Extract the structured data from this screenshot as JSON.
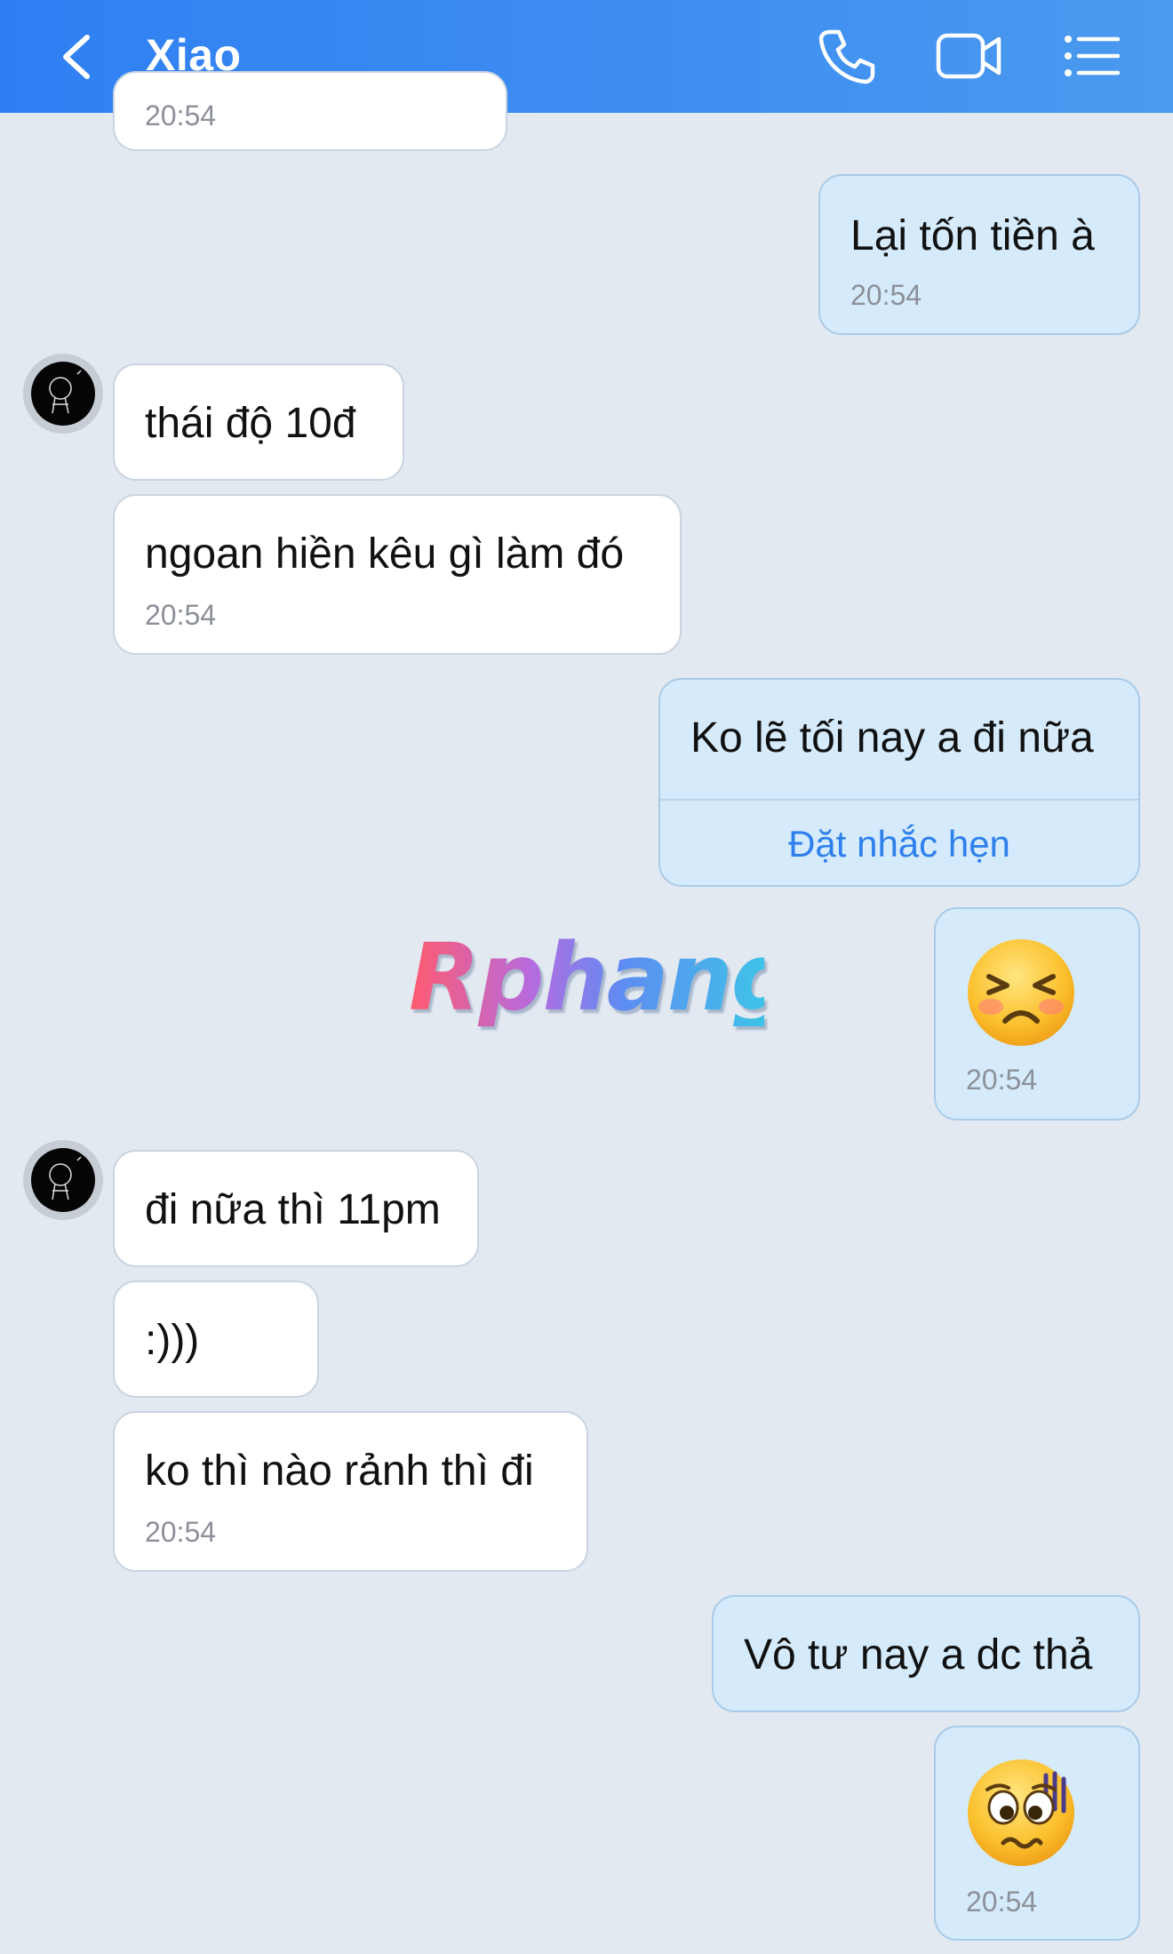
{
  "header": {
    "title": "Xiao",
    "back_icon": "chevron-left-icon",
    "call_icon": "phone-icon",
    "video_icon": "video-camera-icon",
    "menu_icon": "list-menu-icon"
  },
  "colors": {
    "header_start": "#2f7ff3",
    "header_end": "#4a9af0",
    "background": "#e2e9f1",
    "incoming_bubble": "#ffffff",
    "outgoing_bubble": "#d5ebfb",
    "link": "#2f80ed"
  },
  "messages": [
    {
      "dir": "in",
      "time": "20:54"
    },
    {
      "dir": "out",
      "text": "Lại tốn tiền à",
      "time": "20:54"
    },
    {
      "dir": "in",
      "text": "thái độ 10đ"
    },
    {
      "dir": "in",
      "text": "ngoan hiền kêu gì làm đó",
      "time": "20:54"
    },
    {
      "dir": "out",
      "text": "Ko lẽ tối nay a đi nữa",
      "action": "Đặt nhắc hẹn"
    },
    {
      "dir": "out",
      "emoji": "squinting-frown-emoji",
      "time": "20:54"
    },
    {
      "dir": "in",
      "text": "đi nữa thì 11pm"
    },
    {
      "dir": "in",
      "text": ":)))"
    },
    {
      "dir": "in",
      "text": "ko thì nào rảnh thì đi",
      "time": "20:54"
    },
    {
      "dir": "out",
      "text": "Vô tư nay a dc thả"
    },
    {
      "dir": "out",
      "emoji": "worried-sweat-emoji",
      "time": "20:54"
    }
  ],
  "watermark": "Rphang"
}
